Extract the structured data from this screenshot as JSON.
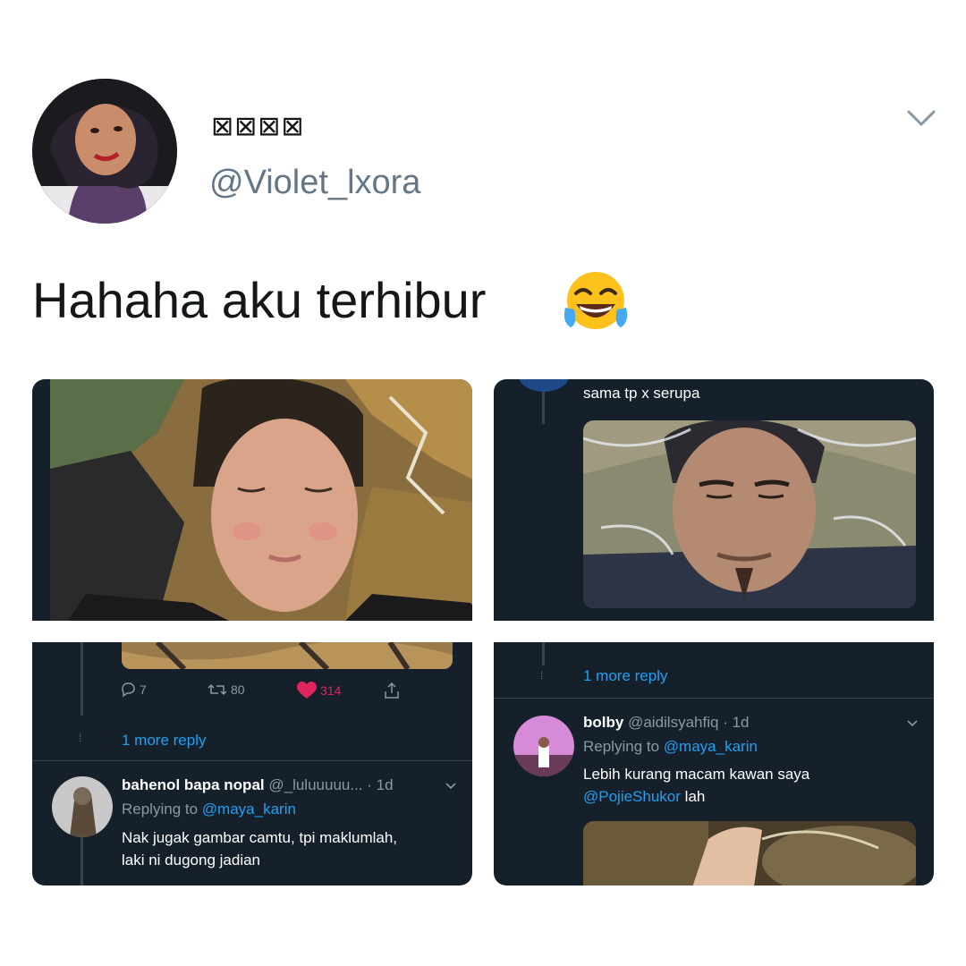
{
  "tweet": {
    "display_name": "⊠⊠⊠⊠",
    "handle": "@Violet_lxora",
    "text": "Hahaha aku terhibur",
    "emoji": "face-with-tears-of-joy-icon"
  },
  "panels": {
    "top_right": {
      "caption": "sama tp x serupa"
    },
    "bottom_left": {
      "actions": {
        "replies": "7",
        "retweets": "80",
        "likes": "314"
      },
      "more_reply": "1 more reply",
      "reply": {
        "name": "bahenol bapa nopal",
        "handle": "@_luluuuuu...",
        "time": "· 1d",
        "replying_prefix": "Replying to",
        "replying_to": "@maya_karin",
        "text_line1": "Nak jugak gambar camtu, tpi maklumlah,",
        "text_line2": "laki ni dugong jadian"
      }
    },
    "bottom_right": {
      "more_reply": "1 more reply",
      "reply": {
        "name": "bolby",
        "handle": "@aidilsyahfiq",
        "time": "· 1d",
        "replying_prefix": "Replying to",
        "replying_to": "@maya_karin",
        "text_line1": "Lebih kurang macam kawan saya",
        "mention": "@PojieShukor",
        "text_after_mention": "lah"
      }
    }
  },
  "colors": {
    "panel_bg": "#15202b",
    "link": "#1da1f2",
    "muted": "#8899a6",
    "like": "#e0245e"
  }
}
